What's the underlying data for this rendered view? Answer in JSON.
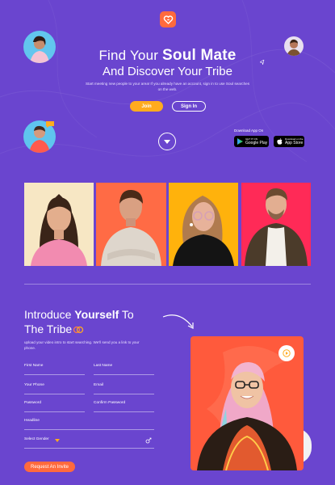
{
  "hero": {
    "title_prefix": "Find Your ",
    "title_highlight": "Soul Mate",
    "title_line2": "And Discover Your Tribe",
    "subtitle": "Start meeting new people to your area! If you already have an account, sign in to use Soul searches on the web.",
    "join_label": "Join",
    "signin_label": "Sign In"
  },
  "download": {
    "label": "Download App On",
    "google_small": "GET IT ON",
    "google": "Google Play",
    "apple_small": "Download on the",
    "apple": "App Store"
  },
  "intro": {
    "line1_prefix": "Introduce ",
    "line1_highlight": "Yourself",
    "line1_suffix": " To",
    "line2": "The Tribe",
    "subtitle": "upload your video intro to start searching. We'll send you a link to your phone."
  },
  "form": {
    "first_name": "First Name",
    "last_name": "Last Name",
    "phone": "Your Phone",
    "email": "Email",
    "password": "Password",
    "confirm_password": "Confirm Password",
    "headline": "Headline",
    "gender": "Select Gender",
    "submit_label": "Request An Invite"
  },
  "colors": {
    "background": "#6a45cf",
    "accent_orange": "#ff6a3d",
    "accent_yellow": "#ffab1e"
  }
}
